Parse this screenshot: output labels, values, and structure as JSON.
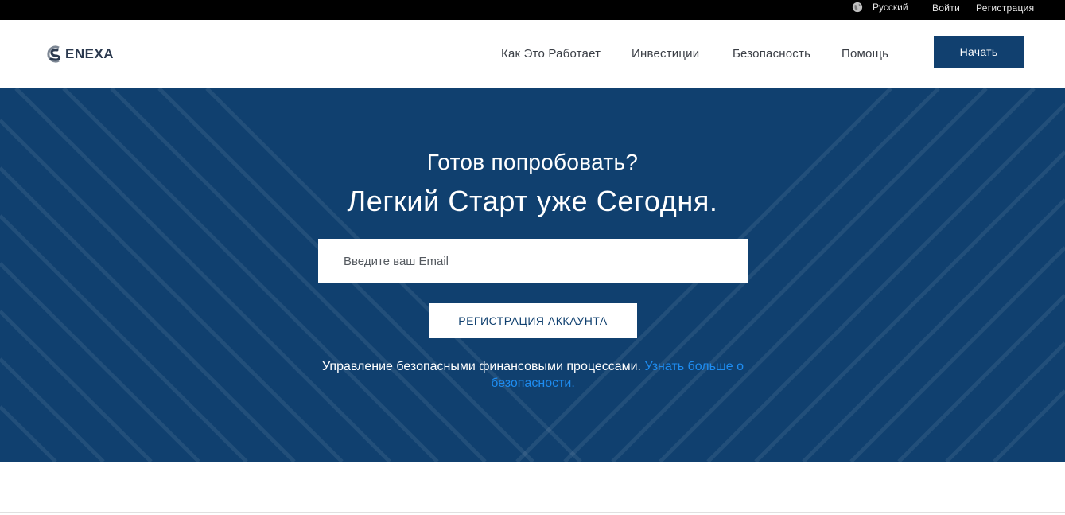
{
  "topbar": {
    "language": "Русский",
    "login": "Войти",
    "register": "Регистрация"
  },
  "header": {
    "logo_text": "ENEXA",
    "nav": [
      {
        "label": "Как Это Работает"
      },
      {
        "label": "Инвестиции"
      },
      {
        "label": "Безопасность"
      },
      {
        "label": "Помощь"
      }
    ],
    "start_button": "Начать"
  },
  "hero": {
    "subtitle": "Готов попробовать?",
    "title": "Легкий Старт уже Сегодня.",
    "email_placeholder": "Введите ваш Email",
    "register_button": "РЕГИСТРАЦИЯ АККАУНТА",
    "security_text": "Управление безопасными финансовыми процессами.",
    "security_link": "Узнать больше о безопасности."
  },
  "colors": {
    "primary": "#10406f",
    "topbar": "#000000",
    "link": "#1e8cf0"
  },
  "icons": {
    "language": "globe-icon",
    "logo": "logo-mark-icon"
  }
}
